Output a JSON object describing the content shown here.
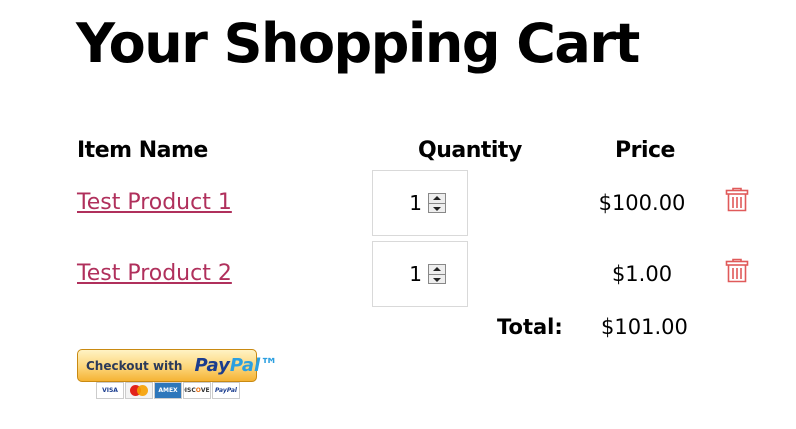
{
  "page": {
    "title": "Your Shopping Cart"
  },
  "table": {
    "headers": {
      "item_name": "Item Name",
      "quantity": "Quantity",
      "price": "Price"
    },
    "rows": [
      {
        "name": "Test Product 1",
        "quantity": "1",
        "price": "$100.00",
        "delete_icon": "trash-icon"
      },
      {
        "name": "Test Product 2",
        "quantity": "1",
        "price": "$1.00",
        "delete_icon": "trash-icon"
      }
    ],
    "total_label": "Total:",
    "total_value": "$101.00"
  },
  "checkout": {
    "button_text": "Checkout with",
    "brand_pay": "Pay",
    "brand_pal": "Pal",
    "brand_tm": "™",
    "cards": [
      "VISA",
      "MasterCard",
      "AMERICAN EXPRESS",
      "DISCOVER",
      "PayPal"
    ]
  },
  "colors": {
    "link": "#b0305c",
    "trash": "#e05a5a",
    "paypal_gold": "#fcd57a",
    "paypal_blue": "#1a3c8e"
  }
}
